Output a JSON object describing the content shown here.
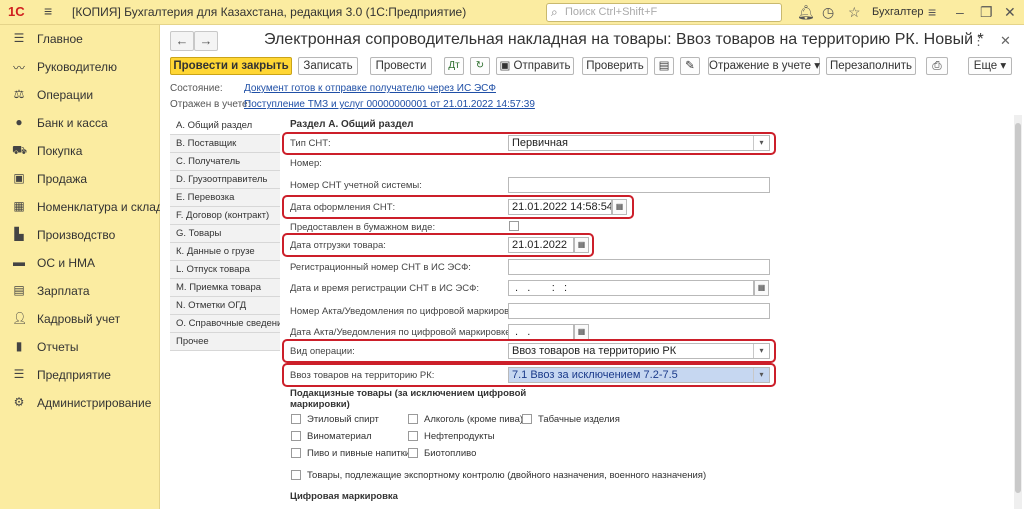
{
  "titlebar": {
    "logo": "1С",
    "title": "[КОПИЯ] Бухгалтерия для Казахстана, редакция 3.0 (1С:Предприятие)",
    "search_placeholder": "Поиск Ctrl+Shift+F",
    "user": "Бухгалтер"
  },
  "sidebar": {
    "items": [
      {
        "icon": "menu-lines-icon",
        "label": "Главное"
      },
      {
        "icon": "trend-icon",
        "label": "Руководителю"
      },
      {
        "icon": "operations-icon",
        "label": "Операции"
      },
      {
        "icon": "bank-icon",
        "label": "Банк и касса"
      },
      {
        "icon": "cart-icon",
        "label": "Покупка"
      },
      {
        "icon": "bag-icon",
        "label": "Продажа"
      },
      {
        "icon": "grid-icon",
        "label": "Номенклатура и склад"
      },
      {
        "icon": "factory-icon",
        "label": "Производство"
      },
      {
        "icon": "truck-icon",
        "label": "ОС и НМА"
      },
      {
        "icon": "payroll-icon",
        "label": "Зарплата"
      },
      {
        "icon": "people-icon",
        "label": "Кадровый учет"
      },
      {
        "icon": "bar-chart-icon",
        "label": "Отчеты"
      },
      {
        "icon": "doc-list-icon",
        "label": "Предприятие"
      },
      {
        "icon": "gear-icon",
        "label": "Администрирование"
      }
    ]
  },
  "doc": {
    "title": "Электронная сопроводительная накладная на товары: Ввоз товаров на территорию РК. Новый *"
  },
  "toolbar": {
    "post_close": "Провести и закрыть",
    "save": "Записать",
    "post": "Провести",
    "send": "Отправить",
    "check": "Проверить",
    "reflect": "Отражение в учете",
    "refill": "Перезаполнить",
    "more": "Еще"
  },
  "meta": {
    "status_label": "Состояние:",
    "status_value": "Документ готов к отправке получателю через ИС ЭСФ",
    "reflected_label": "Отражен в учете:",
    "reflected_value": "Поступление ТМЗ и услуг 00000000001 от 21.01.2022 14:57:39"
  },
  "tabs": [
    "А. Общий раздел",
    "В. Поставщик",
    "С. Получатель",
    "D. Грузоотправитель",
    "Е. Перевозка",
    "F. Договор (контракт)",
    "G. Товары",
    "К. Данные о грузе",
    "L. Отпуск товара",
    "М. Приемка товара",
    "N. Отметки ОГД",
    "О. Справочные сведения",
    "Прочее"
  ],
  "section": {
    "title": "Раздел А. Общий раздел",
    "snt_type_label": "Тип СНТ:",
    "snt_type_value": "Первичная",
    "number_label": "Номер:",
    "acc_number_label": "Номер СНТ учетной системы:",
    "issue_date_label": "Дата оформления СНТ:",
    "issue_date_value": "21.01.2022 14:58:54",
    "paper_label": "Предоставлен в бумажном виде:",
    "ship_date_label": "Дата отгрузки товара:",
    "ship_date_value": "21.01.2022",
    "reg_number_label": "Регистрационный номер СНТ в ИС ЭСФ:",
    "reg_date_label": "Дата и время регистрации СНТ в ИС ЭСФ:",
    "reg_date_mask": " .   .       :   :  ",
    "act_number_label": "Номер Акта/Уведомления по цифровой маркировке:",
    "act_date_label": "Дата Акта/Уведомления по цифровой маркировке:",
    "act_date_mask": " .   .   ",
    "op_type_label": "Вид операции:",
    "op_type_value": "Ввоз товаров на территорию РК",
    "import_label": "Ввоз товаров на территорию РК:",
    "import_value": "7.1 Ввоз за исключением 7.2-7.5",
    "excise_title_1": "Подакцизные товары (за исключением цифровой",
    "excise_title_2": "маркировки)",
    "excise": {
      "ethyl": "Этиловый спирт",
      "alcohol": "Алкоголь (кроме пива)",
      "tobacco": "Табачные изделия",
      "wine": "Виноматериал",
      "oil": "Нефтепродукты",
      "beer": "Пиво и пивные напитки",
      "bio": "Биотопливо",
      "export": "Товары, подлежащие экспортному контролю (двойного назначения, военного назначения)"
    },
    "digital_title": "Цифровая маркировка"
  },
  "colors": {
    "sidebar": "#fbeca1",
    "primary_button": "#ffd634",
    "highlight": "#cc1f2a",
    "link": "#1f4fa6",
    "selection": "#c6d7f1"
  }
}
